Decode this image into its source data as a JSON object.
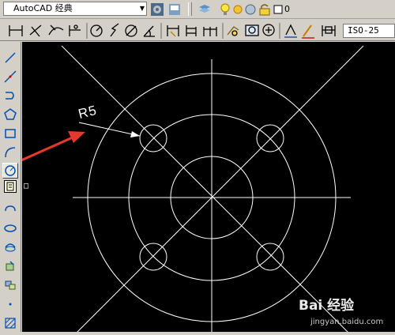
{
  "workspace": {
    "selected": "AutoCAD 经典"
  },
  "layer_toolbar": {
    "current_layer": "0"
  },
  "dimension_toolbar": {
    "dim_style": "ISO-25"
  },
  "tooltip": {
    "icon": "tooltip-icon"
  },
  "drawing": {
    "background": "#000000",
    "line_color": "#ffffff",
    "radius_label": "R5",
    "arrow_color": "#e8372c"
  },
  "watermark": {
    "logo_text": "Bai 经验",
    "url": "jingyan.baidu.com"
  }
}
